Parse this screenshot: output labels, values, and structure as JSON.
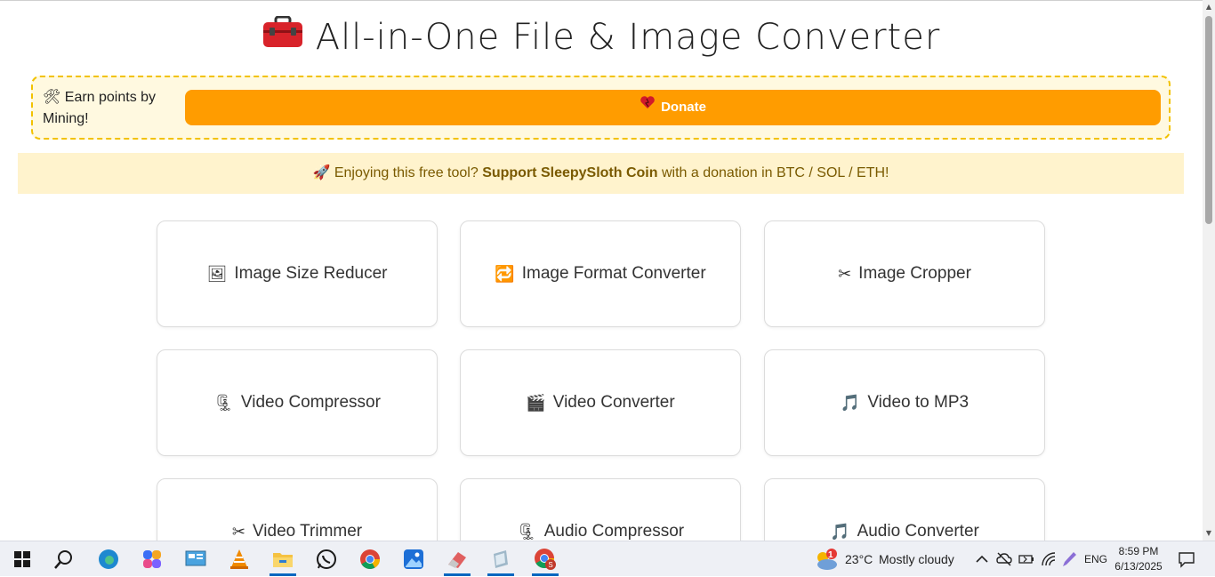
{
  "header": {
    "title": "All-in-One File & Image Converter",
    "icon": "toolbox-icon"
  },
  "mining": {
    "text": "Earn points by Mining!",
    "icon": "hammer-pick-icon"
  },
  "donate": {
    "label": "Donate",
    "icon": "heart-icon"
  },
  "support": {
    "prefix": "Enjoying this free tool?",
    "bold": "Support SleepySloth Coin",
    "suffix": "with a donation in BTC / SOL / ETH!",
    "icon": "rocket-icon"
  },
  "tools": [
    {
      "label": "Image Size Reducer",
      "icon": "framed-picture-icon"
    },
    {
      "label": "Image Format Converter",
      "icon": "repeat-icon"
    },
    {
      "label": "Image Cropper",
      "icon": "scissors-icon"
    },
    {
      "label": "Video Compressor",
      "icon": "clamp-icon"
    },
    {
      "label": "Video Converter",
      "icon": "clapperboard-icon"
    },
    {
      "label": "Video to MP3",
      "icon": "music-notes-icon"
    },
    {
      "label": "Video Trimmer",
      "icon": "scissors-icon"
    },
    {
      "label": "Audio Compressor",
      "icon": "clamp-icon"
    },
    {
      "label": "Audio Converter",
      "icon": "music-notes-icon"
    }
  ],
  "taskbar": {
    "weather": {
      "temp": "23°C",
      "condition": "Mostly cloudy",
      "badge": "1"
    },
    "language": "ENG",
    "time": "8:59 PM",
    "date": "6/13/2025"
  },
  "colors": {
    "donate": "#ff9c00",
    "banner": "#fff3cd",
    "mining_border": "#f2c200"
  }
}
